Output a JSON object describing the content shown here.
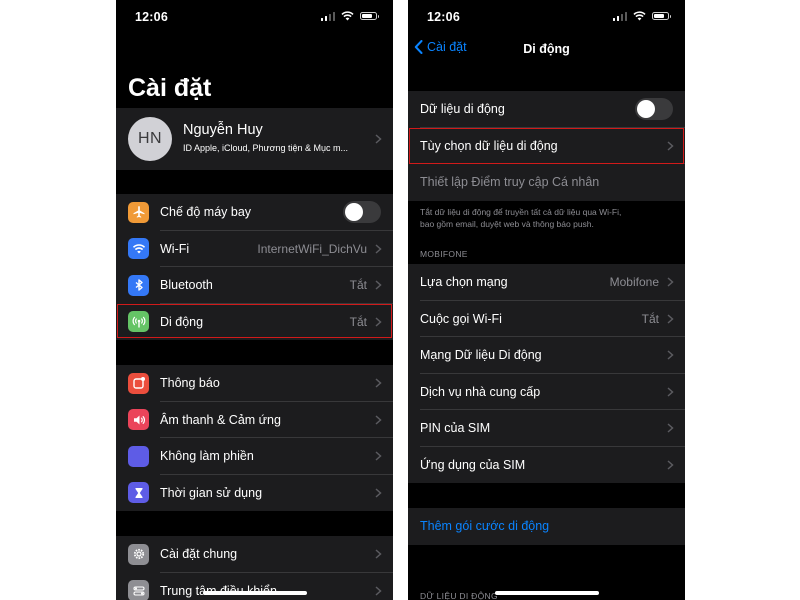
{
  "left": {
    "time": "12:06",
    "title": "Cài đặt",
    "profile": {
      "initials": "HN",
      "name": "Nguyễn Huy",
      "subtitle": "ID Apple, iCloud, Phương tiện & Mục m..."
    },
    "group1": [
      {
        "label": "Chế độ máy bay",
        "icon": "airplane-icon",
        "color": "#f09a37"
      },
      {
        "label": "Wi-Fi",
        "value": "InternetWiFi_DichVu",
        "icon": "wifi-icon",
        "color": "#3478f6"
      },
      {
        "label": "Bluetooth",
        "value": "Tắt",
        "icon": "bluetooth-icon",
        "color": "#3478f6"
      },
      {
        "label": "Di động",
        "value": "Tắt",
        "icon": "antenna-icon",
        "color": "#65c466"
      }
    ],
    "group2": [
      {
        "label": "Thông báo",
        "icon": "notification-icon",
        "color": "#eb4e3d"
      },
      {
        "label": "Âm thanh & Cảm ứng",
        "icon": "speaker-icon",
        "color": "#eb445a"
      },
      {
        "label": "Không làm phiền",
        "icon": "moon-icon",
        "color": "#5e5ce6"
      },
      {
        "label": "Thời gian sử dụng",
        "icon": "hourglass-icon",
        "color": "#5e5ce6"
      }
    ],
    "group3": [
      {
        "label": "Cài đặt chung",
        "icon": "gear-icon",
        "color": "#8e8e93"
      },
      {
        "label": "Trung tâm điều khiển",
        "icon": "control-center-icon",
        "color": "#8e8e93"
      }
    ]
  },
  "right": {
    "time": "12:06",
    "back_label": "Cài đặt",
    "nav_title": "Di động",
    "cellular_data_label": "Dữ liệu di động",
    "cellular_options_label": "Tùy chọn dữ liệu di động",
    "hotspot_label": "Thiết lập Điểm truy cập Cá nhân",
    "footer_line1": "Tắt dữ liệu di động để truyền tất cả dữ liệu qua Wi-Fi,",
    "footer_line2": "bao gồm email, duyệt web và thông báo push.",
    "section_carrier": "MOBIFONE",
    "carrier_rows": [
      {
        "label": "Lựa chọn mạng",
        "value": "Mobifone"
      },
      {
        "label": "Cuộc gọi Wi-Fi",
        "value": "Tắt"
      },
      {
        "label": "Mạng Dữ liệu Di động",
        "value": ""
      },
      {
        "label": "Dịch vụ nhà cung cấp",
        "value": ""
      },
      {
        "label": "PIN của SIM",
        "value": ""
      },
      {
        "label": "Ứng dụng của SIM",
        "value": ""
      }
    ],
    "add_plan_label": "Thêm gói cước di động",
    "section_data": "DỮ LIỆU DI ĐỘNG"
  },
  "colors": {
    "accent": "#0a84ff",
    "highlight": "#d11a1a",
    "background": "#000000",
    "cell": "#1c1c1e"
  },
  "toggles": {
    "airplane_mode": false,
    "cellular_data": false
  }
}
